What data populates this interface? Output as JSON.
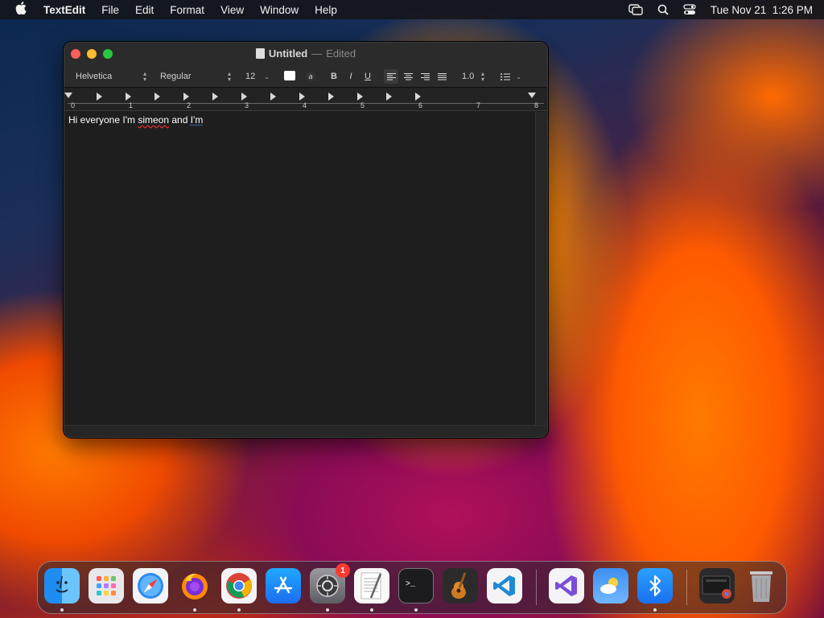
{
  "menubar": {
    "apple_icon": "apple-logo",
    "app_name": "TextEdit",
    "items": [
      "File",
      "Edit",
      "Format",
      "View",
      "Window",
      "Help"
    ],
    "clock": "Tue Nov 21  1:26 PM"
  },
  "window": {
    "title": "Untitled",
    "separator": "—",
    "state": "Edited"
  },
  "toolbar": {
    "font_family": "Helvetica",
    "font_style": "Regular",
    "font_size": "12",
    "text_color": "#ffffff",
    "bold": "B",
    "italic": "I",
    "underline": "U",
    "line_spacing": "1.0"
  },
  "ruler": {
    "numbers": [
      "0",
      "1",
      "2",
      "3",
      "4",
      "5",
      "6",
      "7",
      "8"
    ]
  },
  "document": {
    "text_before": "Hi everyone I'm ",
    "misspelled_word": "simeon",
    "text_middle": " and ",
    "grammar_word": "I'm"
  },
  "dock": {
    "apps": [
      "Finder",
      "Launchpad",
      "Safari",
      "Firefox",
      "Google Chrome",
      "App Store",
      "System Settings",
      "TextEdit",
      "Terminal",
      "GarageBand",
      "Visual Studio Code",
      "Visual Studio",
      "Weather",
      "Bluetooth File Exchange",
      "Downloads",
      "Trash"
    ],
    "system_settings_badge": "1"
  }
}
